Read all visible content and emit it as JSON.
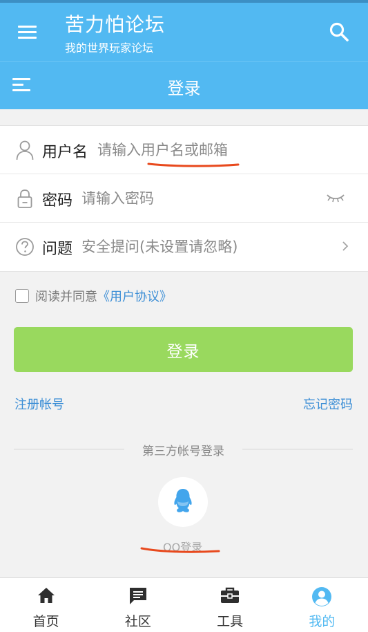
{
  "header": {
    "title": "苦力怕论坛",
    "subtitle": "我的世界玩家论坛"
  },
  "subheader": {
    "title": "登录"
  },
  "form": {
    "username": {
      "label": "用户名",
      "placeholder": "请输入用户名或邮箱"
    },
    "password": {
      "label": "密码",
      "placeholder": "请输入密码"
    },
    "question": {
      "label": "问题",
      "placeholder": "安全提问(未设置请忽略)"
    }
  },
  "agreement": {
    "prefix": "阅读并同意",
    "link": "《用户协议》"
  },
  "actions": {
    "login_label": "登录",
    "register_label": "注册帐号",
    "forgot_label": "忘记密码"
  },
  "third_party": {
    "heading": "第三方帐号登录",
    "qq_label": "QQ登录"
  },
  "tabs": [
    {
      "label": "首页",
      "icon": "home-icon"
    },
    {
      "label": "社区",
      "icon": "chat-icon"
    },
    {
      "label": "工具",
      "icon": "toolbox-icon"
    },
    {
      "label": "我的",
      "icon": "user-icon",
      "active": true
    }
  ],
  "colors": {
    "primary": "#52b9f2",
    "login_button": "#99d95e",
    "link": "#3d8fd6",
    "annotation": "#e8491d"
  }
}
